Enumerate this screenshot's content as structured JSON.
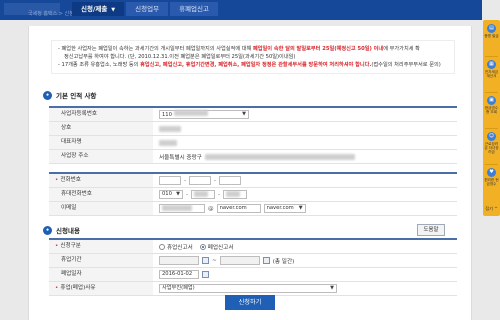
{
  "nav": {
    "crumbs": "국세청 홈택스 > 신청/제출 > 신청업무",
    "menu_main": "신청/제출",
    "menu_sub1": "신청업무",
    "menu_sub2": "휴폐업신고"
  },
  "notice": {
    "line1a": "- 폐업한 사업자는 폐업일이 속하는 과세기간의 개시일부터 폐업일까지의 사업실적에 대해 ",
    "line1b": "폐업일이 속한 달의 말일로부터 25일(예정신고 50일) 이내",
    "line1c": "에 부가가치세 확",
    "line2": "정신고납부를 하여야 합니다. (단, 2010.12.31.이전 폐업분은 폐업일로부터 25일(과세기간 50일)이내임)",
    "line3a": "- 17개종 조류 유흥업소, 노래방 등의 ",
    "line3b": "휴업신고, 폐업신고, 휴업기간변경, 폐업취소, 폐업일자 정정은 관할세무서를 방문하여 처리하셔야 합니다.",
    "line3c": "(접수일의 처리주무부서로 문의)"
  },
  "basic": {
    "title": "기본 인적 사항",
    "rows": [
      {
        "label": "사업자등록번호",
        "value": "110"
      },
      {
        "label": "상호",
        "value": ""
      },
      {
        "label": "대표자명",
        "value": ""
      },
      {
        "label": "사업장 주소",
        "value": "서울특별시 중랑구"
      }
    ],
    "phone_label": "전화번호",
    "mobile_label": "휴대전화번호",
    "mobile_prefix": "010",
    "email_label": "이메일",
    "email_at": "@",
    "email_domain": "naver.com",
    "email_domain_select": "naver.com"
  },
  "apply": {
    "title": "신청내용",
    "help_button": "도움말",
    "type_label": "신청구분",
    "type_option1": "휴업신고서",
    "type_option2": "폐업신고서",
    "type_selected": "폐업신고서",
    "period_label": "휴업기간",
    "period_sep": "~",
    "period_days": "(총   일간)",
    "closure_label": "폐업일자",
    "closure_date": "2016-01-02",
    "reason_label": "휴업(폐업)사유",
    "reason_value": "사업부진(폐업)",
    "submit": "신청하기"
  },
  "quick_menu": [
    {
      "icon": "document-icon",
      "label": "증명 발급"
    },
    {
      "icon": "calculator-icon",
      "label": "전자세금 계산서"
    },
    {
      "icon": "receipt-icon",
      "label": "현금영수 증 조회"
    },
    {
      "icon": "person-icon",
      "label": "근로장려금 자녀장려금"
    },
    {
      "icon": "heart-icon",
      "label": "편리한 현금영수"
    }
  ],
  "quick_more": "접기 ^"
}
